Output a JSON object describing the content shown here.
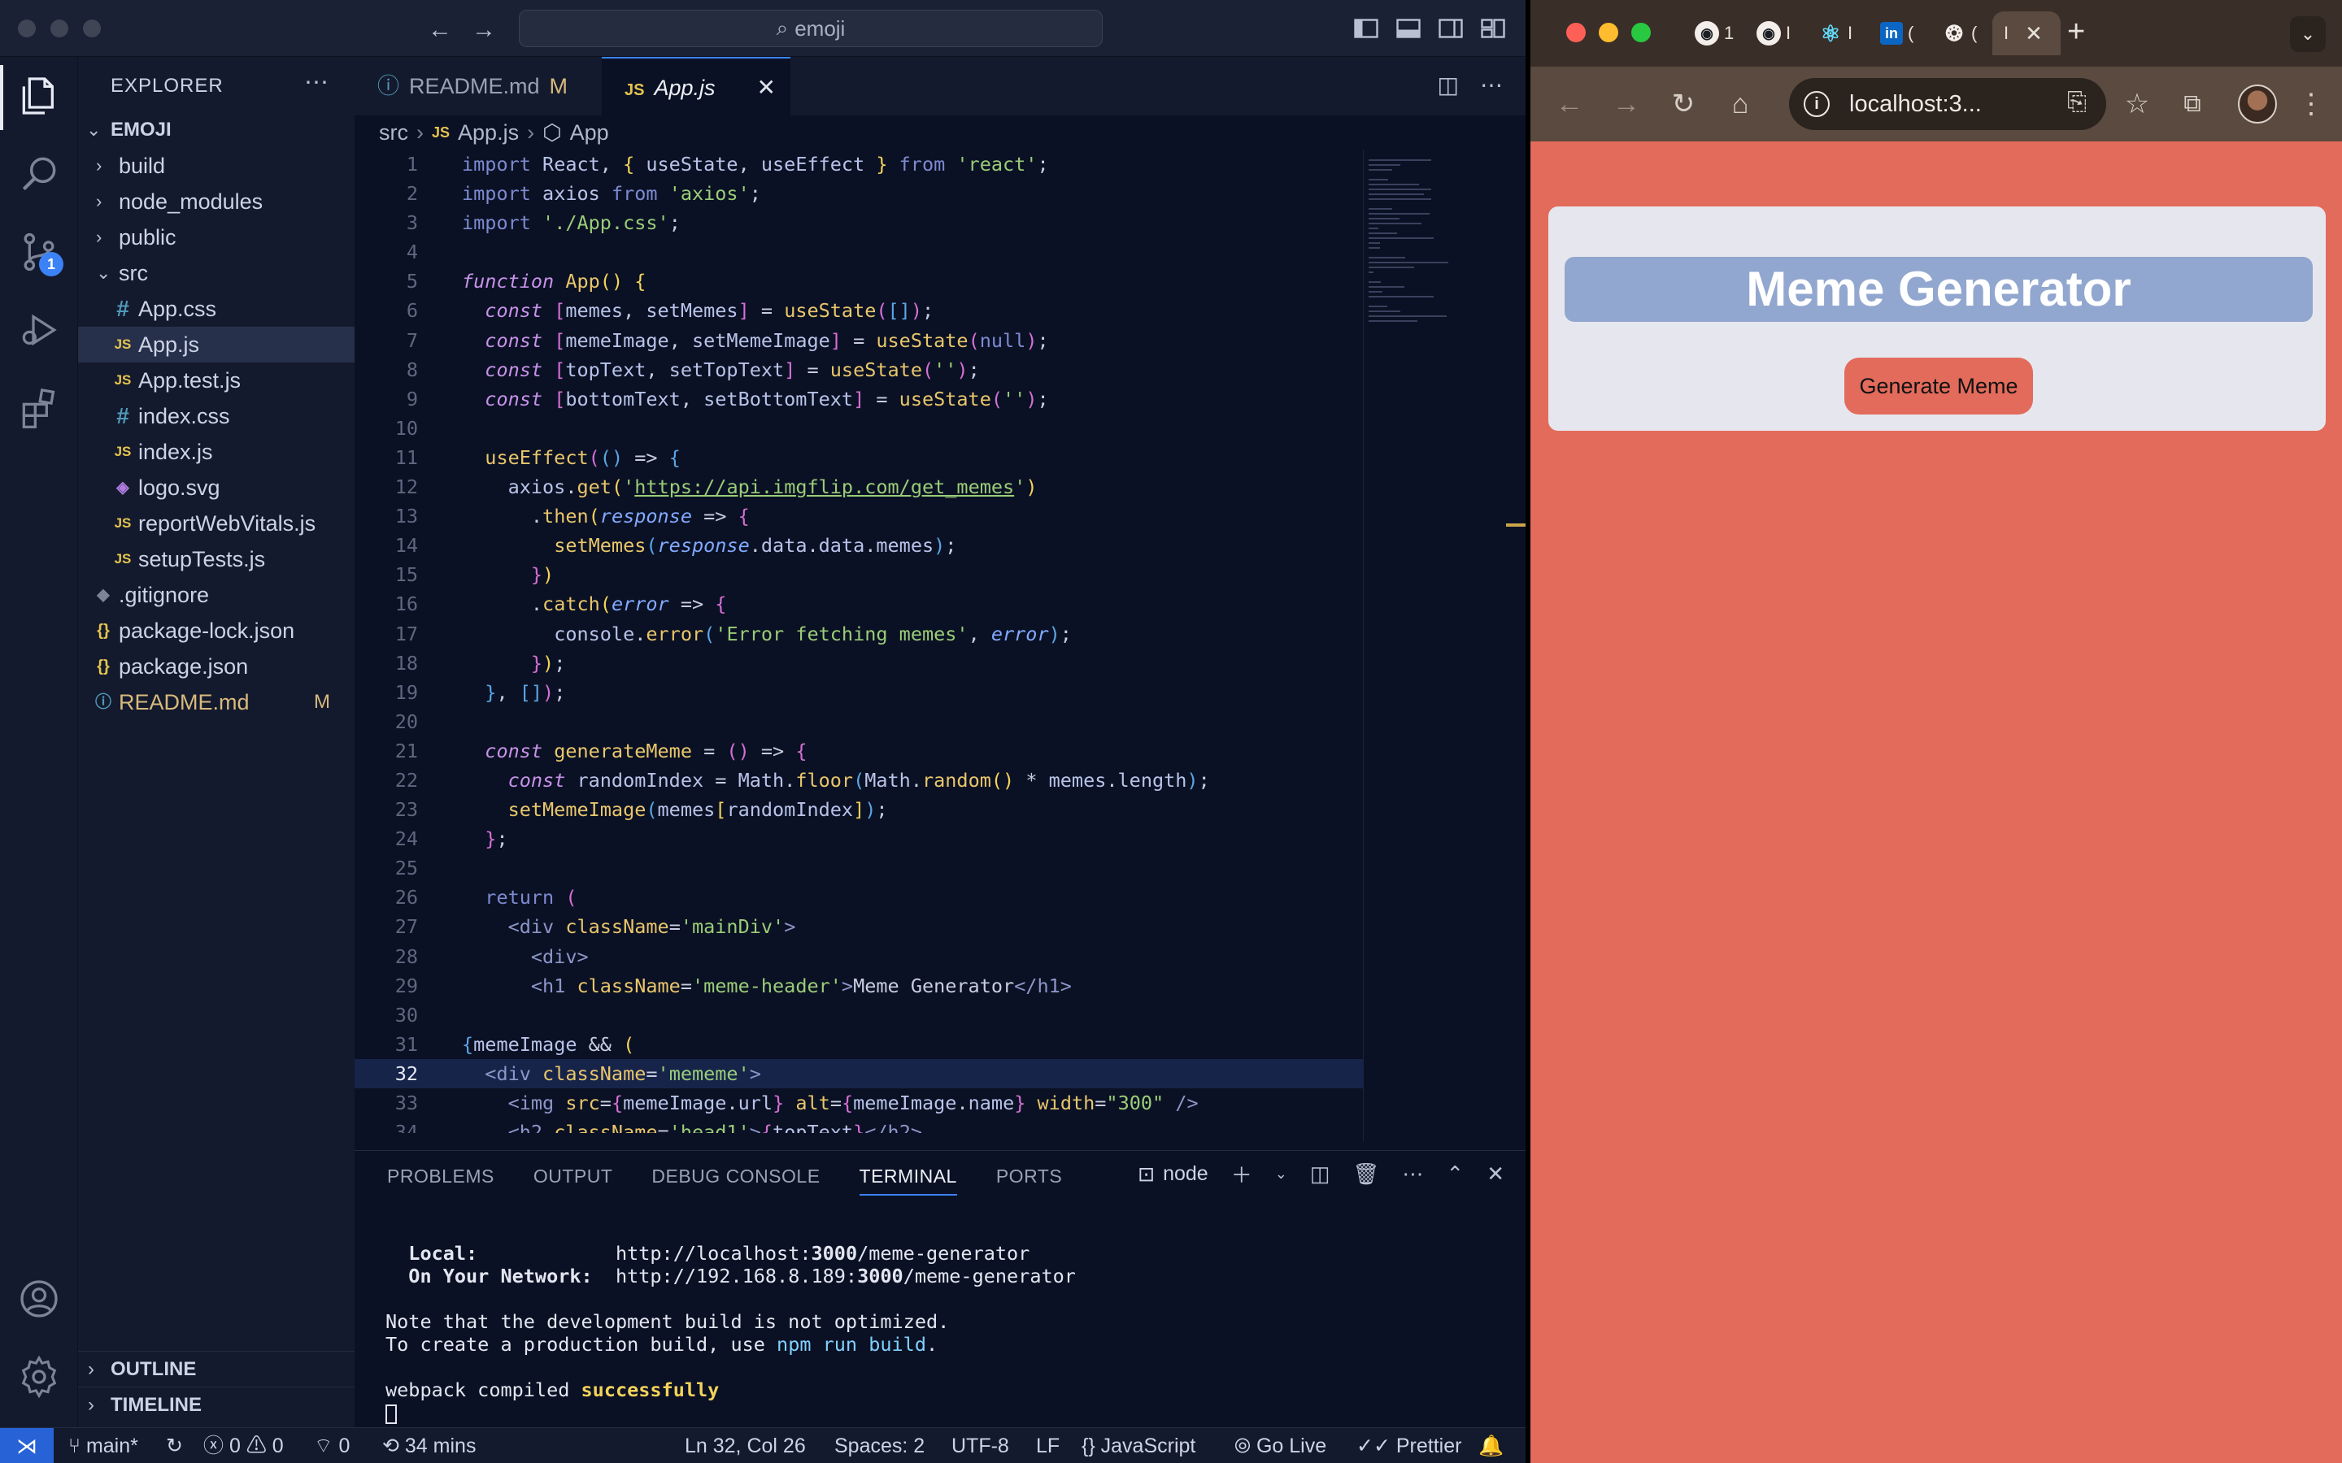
{
  "vscode": {
    "search_text": "emoji",
    "scm_badge": "1",
    "explorer": {
      "title": "EXPLORER",
      "root": "EMOJI",
      "items": [
        {
          "label": "build",
          "kind": "folder",
          "depth": 1
        },
        {
          "label": "node_modules",
          "kind": "folder",
          "depth": 1
        },
        {
          "label": "public",
          "kind": "folder",
          "depth": 1
        },
        {
          "label": "src",
          "kind": "folder-open",
          "depth": 1
        },
        {
          "label": "App.css",
          "kind": "css",
          "depth": 2
        },
        {
          "label": "App.js",
          "kind": "js",
          "depth": 2,
          "selected": true
        },
        {
          "label": "App.test.js",
          "kind": "js",
          "depth": 2
        },
        {
          "label": "index.css",
          "kind": "css",
          "depth": 2
        },
        {
          "label": "index.js",
          "kind": "js",
          "depth": 2
        },
        {
          "label": "logo.svg",
          "kind": "svg",
          "depth": 2
        },
        {
          "label": "reportWebVitals.js",
          "kind": "js",
          "depth": 2
        },
        {
          "label": "setupTests.js",
          "kind": "js",
          "depth": 2
        },
        {
          "label": ".gitignore",
          "kind": "git",
          "depth": 1
        },
        {
          "label": "package-lock.json",
          "kind": "json",
          "depth": 1
        },
        {
          "label": "package.json",
          "kind": "json",
          "depth": 1
        },
        {
          "label": "README.md",
          "kind": "md",
          "depth": 1,
          "status": "M"
        }
      ],
      "outline": "OUTLINE",
      "timeline": "TIMELINE"
    },
    "tabs": [
      {
        "label": "README.md",
        "status": "M",
        "active": false
      },
      {
        "label": "App.js",
        "active": true
      }
    ],
    "breadcrumb": [
      "src",
      "App.js",
      "App"
    ],
    "current_line": 32,
    "code": [
      [
        [
          "kw",
          "import "
        ],
        [
          "var",
          "React"
        ],
        [
          "pun",
          ", "
        ],
        [
          "br1",
          "{ "
        ],
        [
          "var",
          "useState"
        ],
        [
          "pun",
          ", "
        ],
        [
          "var",
          "useEffect"
        ],
        [
          "br1",
          " }"
        ],
        [
          "kw",
          " from "
        ],
        [
          "str",
          "'react'"
        ],
        [
          "pun",
          ";"
        ]
      ],
      [
        [
          "kw",
          "import "
        ],
        [
          "var",
          "axios"
        ],
        [
          "kw",
          " from "
        ],
        [
          "str",
          "'axios'"
        ],
        [
          "pun",
          ";"
        ]
      ],
      [
        [
          "kw",
          "import "
        ],
        [
          "str",
          "'./App.css'"
        ],
        [
          "pun",
          ";"
        ]
      ],
      [],
      [
        [
          "kwi",
          "function "
        ],
        [
          "fn",
          "App"
        ],
        [
          "br1",
          "() {"
        ]
      ],
      [
        [
          "pun",
          "  "
        ],
        [
          "kwi",
          "const "
        ],
        [
          "br2",
          "["
        ],
        [
          "var",
          "memes"
        ],
        [
          "pun",
          ", "
        ],
        [
          "var",
          "setMemes"
        ],
        [
          "br2",
          "]"
        ],
        [
          "pun",
          " = "
        ],
        [
          "fn",
          "useState"
        ],
        [
          "br2",
          "("
        ],
        [
          "br3",
          "[]"
        ],
        [
          "br2",
          ")"
        ],
        [
          "pun",
          ";"
        ]
      ],
      [
        [
          "pun",
          "  "
        ],
        [
          "kwi",
          "const "
        ],
        [
          "br2",
          "["
        ],
        [
          "var",
          "memeImage"
        ],
        [
          "pun",
          ", "
        ],
        [
          "var",
          "setMemeImage"
        ],
        [
          "br2",
          "]"
        ],
        [
          "pun",
          " = "
        ],
        [
          "fn",
          "useState"
        ],
        [
          "br2",
          "("
        ],
        [
          "kw",
          "null"
        ],
        [
          "br2",
          ")"
        ],
        [
          "pun",
          ";"
        ]
      ],
      [
        [
          "pun",
          "  "
        ],
        [
          "kwi",
          "const "
        ],
        [
          "br2",
          "["
        ],
        [
          "var",
          "topText"
        ],
        [
          "pun",
          ", "
        ],
        [
          "var",
          "setTopText"
        ],
        [
          "br2",
          "]"
        ],
        [
          "pun",
          " = "
        ],
        [
          "fn",
          "useState"
        ],
        [
          "br2",
          "("
        ],
        [
          "str",
          "''"
        ],
        [
          "br2",
          ")"
        ],
        [
          "pun",
          ";"
        ]
      ],
      [
        [
          "pun",
          "  "
        ],
        [
          "kwi",
          "const "
        ],
        [
          "br2",
          "["
        ],
        [
          "var",
          "bottomText"
        ],
        [
          "pun",
          ", "
        ],
        [
          "var",
          "setBottomText"
        ],
        [
          "br2",
          "]"
        ],
        [
          "pun",
          " = "
        ],
        [
          "fn",
          "useState"
        ],
        [
          "br2",
          "("
        ],
        [
          "str",
          "''"
        ],
        [
          "br2",
          ")"
        ],
        [
          "pun",
          ";"
        ]
      ],
      [],
      [
        [
          "pun",
          "  "
        ],
        [
          "fn",
          "useEffect"
        ],
        [
          "br2",
          "("
        ],
        [
          "br3",
          "()"
        ],
        [
          "pun",
          " => "
        ],
        [
          "br3",
          "{"
        ]
      ],
      [
        [
          "pun",
          "    "
        ],
        [
          "var",
          "axios"
        ],
        [
          "pun",
          "."
        ],
        [
          "fn",
          "get"
        ],
        [
          "br1",
          "("
        ],
        [
          "str",
          "'"
        ],
        [
          "url",
          "https://api.imgflip.com/get_memes"
        ],
        [
          "str",
          "'"
        ],
        [
          "br1",
          ")"
        ]
      ],
      [
        [
          "pun",
          "      ."
        ],
        [
          "fn",
          "then"
        ],
        [
          "br1",
          "("
        ],
        [
          "par",
          "response"
        ],
        [
          "pun",
          " => "
        ],
        [
          "br2",
          "{"
        ]
      ],
      [
        [
          "pun",
          "        "
        ],
        [
          "fn",
          "setMemes"
        ],
        [
          "br3",
          "("
        ],
        [
          "par",
          "response"
        ],
        [
          "pun",
          "."
        ],
        [
          "prop",
          "data"
        ],
        [
          "pun",
          "."
        ],
        [
          "prop",
          "data"
        ],
        [
          "pun",
          "."
        ],
        [
          "prop",
          "memes"
        ],
        [
          "br3",
          ")"
        ],
        [
          "pun",
          ";"
        ]
      ],
      [
        [
          "pun",
          "      "
        ],
        [
          "br2",
          "}"
        ],
        [
          "br1",
          ")"
        ]
      ],
      [
        [
          "pun",
          "      ."
        ],
        [
          "fn",
          "catch"
        ],
        [
          "br1",
          "("
        ],
        [
          "par",
          "error"
        ],
        [
          "pun",
          " => "
        ],
        [
          "br2",
          "{"
        ]
      ],
      [
        [
          "pun",
          "        "
        ],
        [
          "var",
          "console"
        ],
        [
          "pun",
          "."
        ],
        [
          "fn",
          "error"
        ],
        [
          "br3",
          "("
        ],
        [
          "str",
          "'Error fetching memes'"
        ],
        [
          "pun",
          ", "
        ],
        [
          "par",
          "error"
        ],
        [
          "br3",
          ")"
        ],
        [
          "pun",
          ";"
        ]
      ],
      [
        [
          "pun",
          "      "
        ],
        [
          "br2",
          "}"
        ],
        [
          "br1",
          ")"
        ],
        [
          "pun",
          ";"
        ]
      ],
      [
        [
          "pun",
          "  "
        ],
        [
          "br3",
          "}"
        ],
        [
          "pun",
          ", "
        ],
        [
          "br3",
          "[]"
        ],
        [
          "br2",
          ")"
        ],
        [
          "pun",
          ";"
        ]
      ],
      [],
      [
        [
          "pun",
          "  "
        ],
        [
          "kwi",
          "const "
        ],
        [
          "fn",
          "generateMeme"
        ],
        [
          "pun",
          " = "
        ],
        [
          "br2",
          "()"
        ],
        [
          "pun",
          " => "
        ],
        [
          "br2",
          "{"
        ]
      ],
      [
        [
          "pun",
          "    "
        ],
        [
          "kwi",
          "const "
        ],
        [
          "var",
          "randomIndex"
        ],
        [
          "pun",
          " = "
        ],
        [
          "var",
          "Math"
        ],
        [
          "pun",
          "."
        ],
        [
          "fn",
          "floor"
        ],
        [
          "br3",
          "("
        ],
        [
          "var",
          "Math"
        ],
        [
          "pun",
          "."
        ],
        [
          "fn",
          "random"
        ],
        [
          "br1",
          "()"
        ],
        [
          "pun",
          " * "
        ],
        [
          "var",
          "memes"
        ],
        [
          "pun",
          "."
        ],
        [
          "prop",
          "length"
        ],
        [
          "br3",
          ")"
        ],
        [
          "pun",
          ";"
        ]
      ],
      [
        [
          "pun",
          "    "
        ],
        [
          "fn",
          "setMemeImage"
        ],
        [
          "br3",
          "("
        ],
        [
          "var",
          "memes"
        ],
        [
          "br1",
          "["
        ],
        [
          "var",
          "randomIndex"
        ],
        [
          "br1",
          "]"
        ],
        [
          "br3",
          ")"
        ],
        [
          "pun",
          ";"
        ]
      ],
      [
        [
          "pun",
          "  "
        ],
        [
          "br2",
          "}"
        ],
        [
          "pun",
          ";"
        ]
      ],
      [],
      [
        [
          "pun",
          "  "
        ],
        [
          "kw",
          "return "
        ],
        [
          "br2",
          "("
        ]
      ],
      [
        [
          "pun",
          "    "
        ],
        [
          "tag",
          "<div "
        ],
        [
          "attr",
          "className"
        ],
        [
          "pun",
          "="
        ],
        [
          "str",
          "'mainDiv'"
        ],
        [
          "tag",
          ">"
        ]
      ],
      [
        [
          "pun",
          "      "
        ],
        [
          "tag",
          "<div>"
        ]
      ],
      [
        [
          "pun",
          "      "
        ],
        [
          "tag",
          "<h1 "
        ],
        [
          "attr",
          "className"
        ],
        [
          "pun",
          "="
        ],
        [
          "str",
          "'meme-header'"
        ],
        [
          "tag",
          ">"
        ],
        [
          "txt",
          "Meme Generator"
        ],
        [
          "tag",
          "</h1>"
        ]
      ],
      [],
      [
        [
          "br3",
          "{"
        ],
        [
          "var",
          "memeImage"
        ],
        [
          "pun",
          " && "
        ],
        [
          "br1",
          "("
        ]
      ],
      [
        [
          "pun",
          "  "
        ],
        [
          "tag",
          "<div "
        ],
        [
          "attr",
          "className"
        ],
        [
          "pun",
          "="
        ],
        [
          "str",
          "'mememe'"
        ],
        [
          "tag",
          ">"
        ]
      ],
      [
        [
          "pun",
          "    "
        ],
        [
          "tag",
          "<img "
        ],
        [
          "attr",
          "src"
        ],
        [
          "pun",
          "="
        ],
        [
          "br2",
          "{"
        ],
        [
          "var",
          "memeImage"
        ],
        [
          "pun",
          "."
        ],
        [
          "prop",
          "url"
        ],
        [
          "br2",
          "}"
        ],
        [
          "attr",
          " alt"
        ],
        [
          "pun",
          "="
        ],
        [
          "br2",
          "{"
        ],
        [
          "var",
          "memeImage"
        ],
        [
          "pun",
          "."
        ],
        [
          "prop",
          "name"
        ],
        [
          "br2",
          "}"
        ],
        [
          "attr",
          " width"
        ],
        [
          "pun",
          "="
        ],
        [
          "str",
          "\"300\""
        ],
        [
          "tag",
          " />"
        ]
      ],
      [
        [
          "pun",
          "    "
        ],
        [
          "tag",
          "<h2 "
        ],
        [
          "attr",
          "className"
        ],
        [
          "pun",
          "="
        ],
        [
          "str",
          "'head1'"
        ],
        [
          "tag",
          ">"
        ],
        [
          "br2",
          "{"
        ],
        [
          "var",
          "topText"
        ],
        [
          "br2",
          "}"
        ],
        [
          "tag",
          "</h2>"
        ]
      ]
    ],
    "panel": {
      "tabs": [
        "PROBLEMS",
        "OUTPUT",
        "DEBUG CONSOLE",
        "TERMINAL",
        "PORTS"
      ],
      "active_tab": "TERMINAL",
      "terminal_name": "node",
      "lines": {
        "local_label": "Local:",
        "local_prefix": "http://localhost:",
        "local_port": "3000",
        "local_path": "/meme-generator",
        "network_label": "On Your Network:",
        "network_prefix": "http://192.168.8.189:",
        "network_port": "3000",
        "network_path": "/meme-generator",
        "note1": "Note that the development build is not optimized.",
        "note2_prefix": "To create a production build, use ",
        "note2_cmd": "npm run build",
        "note2_suffix": ".",
        "compiled_prefix": "webpack compiled ",
        "compiled_status": "successfully"
      }
    },
    "statusbar": {
      "branch": "main*",
      "errors": "0",
      "warnings": "0",
      "ports": "0",
      "time": "34 mins",
      "position": "Ln 32, Col 26",
      "spaces": "Spaces: 2",
      "encoding": "UTF-8",
      "eol": "LF",
      "language": "JavaScript",
      "golive": "Go Live",
      "prettier": "Prettier"
    }
  },
  "chrome": {
    "tabs": [
      {
        "icon": "github-icon",
        "label": "1"
      },
      {
        "icon": "github-icon",
        "label": "I"
      },
      {
        "icon": "react-icon",
        "label": "I"
      },
      {
        "icon": "linkedin-icon",
        "label": "("
      },
      {
        "icon": "openai-icon",
        "label": "("
      },
      {
        "icon": "",
        "label": "I",
        "active": true
      }
    ],
    "url": "localhost:3...",
    "page": {
      "header": "Meme Generator",
      "button": "Generate Meme",
      "background": "#e36b5b",
      "header_bg": "#92a7cf"
    }
  }
}
